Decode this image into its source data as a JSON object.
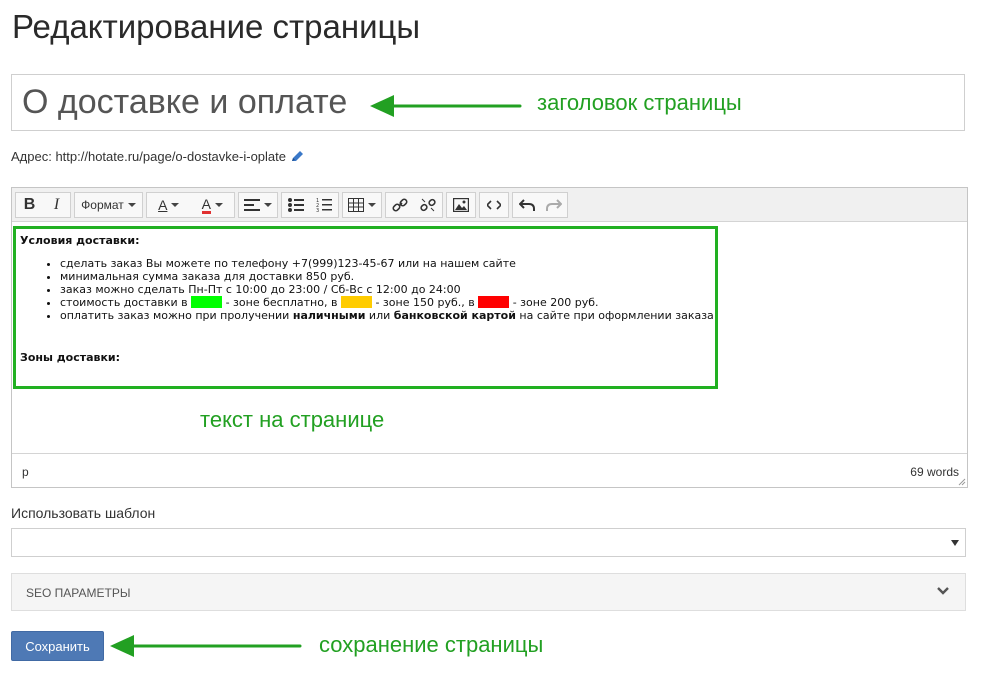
{
  "page": {
    "heading": "Редактирование страницы",
    "title_value": "О доставке и оплате",
    "url_label": "Адрес:",
    "url_value": "http://hotate.ru/page/o-dostavke-i-oplate"
  },
  "annotations": {
    "title": "заголовок страницы",
    "text": "текст на странице",
    "save": "сохранение страницы",
    "arrow_color": "#22a022"
  },
  "editor": {
    "toolbar": {
      "bold": "B",
      "italic": "I",
      "format": "Формат",
      "font_color": "A",
      "bg_color": "A",
      "icons": [
        "bold-icon",
        "italic-icon",
        "format-dropdown",
        "font-color-icon",
        "background-color-icon",
        "align-icon",
        "bullet-list-icon",
        "numbered-list-icon",
        "table-icon",
        "link-icon",
        "unlink-icon",
        "image-icon",
        "source-code-icon",
        "undo-icon",
        "redo-icon"
      ]
    },
    "content": {
      "heading1": "Условия доставки:",
      "items": [
        {
          "text": "сделать заказ Вы можете по телефону +7(999)123-45-67 или на нашем сайте"
        },
        {
          "text": "минимальная сумма заказа для доставки 850 руб."
        },
        {
          "text": "заказ можно сделать Пн-Пт с 10:00 до 23:00 / Сб-Вс с 12:00 до 24:00"
        }
      ],
      "cost_item": {
        "p1": "стоимость доставки в ",
        "p2": " - зоне бесплатно, в ",
        "p3": " - зоне 150 руб., в ",
        "p4": " - зоне 200 руб.",
        "colors": [
          "#00ff00",
          "#ffcc00",
          "#ff0000"
        ]
      },
      "pay_item": {
        "p1": "оплатить заказ можно при пролучении ",
        "b1": "наличными",
        "p2": " или ",
        "b2": "банковской картой",
        "p3": " на сайте при оформлении заказа"
      },
      "heading2": "Зоны доставки:",
      "frame_color": "#21b021"
    },
    "status": {
      "path": "p",
      "words": "69 words"
    }
  },
  "template": {
    "label": "Использовать шаблон",
    "selected": ""
  },
  "seo": {
    "label": "SEO ПАРАМЕТРЫ"
  },
  "actions": {
    "save_label": "Сохранить",
    "accent": "#4e79b5"
  }
}
